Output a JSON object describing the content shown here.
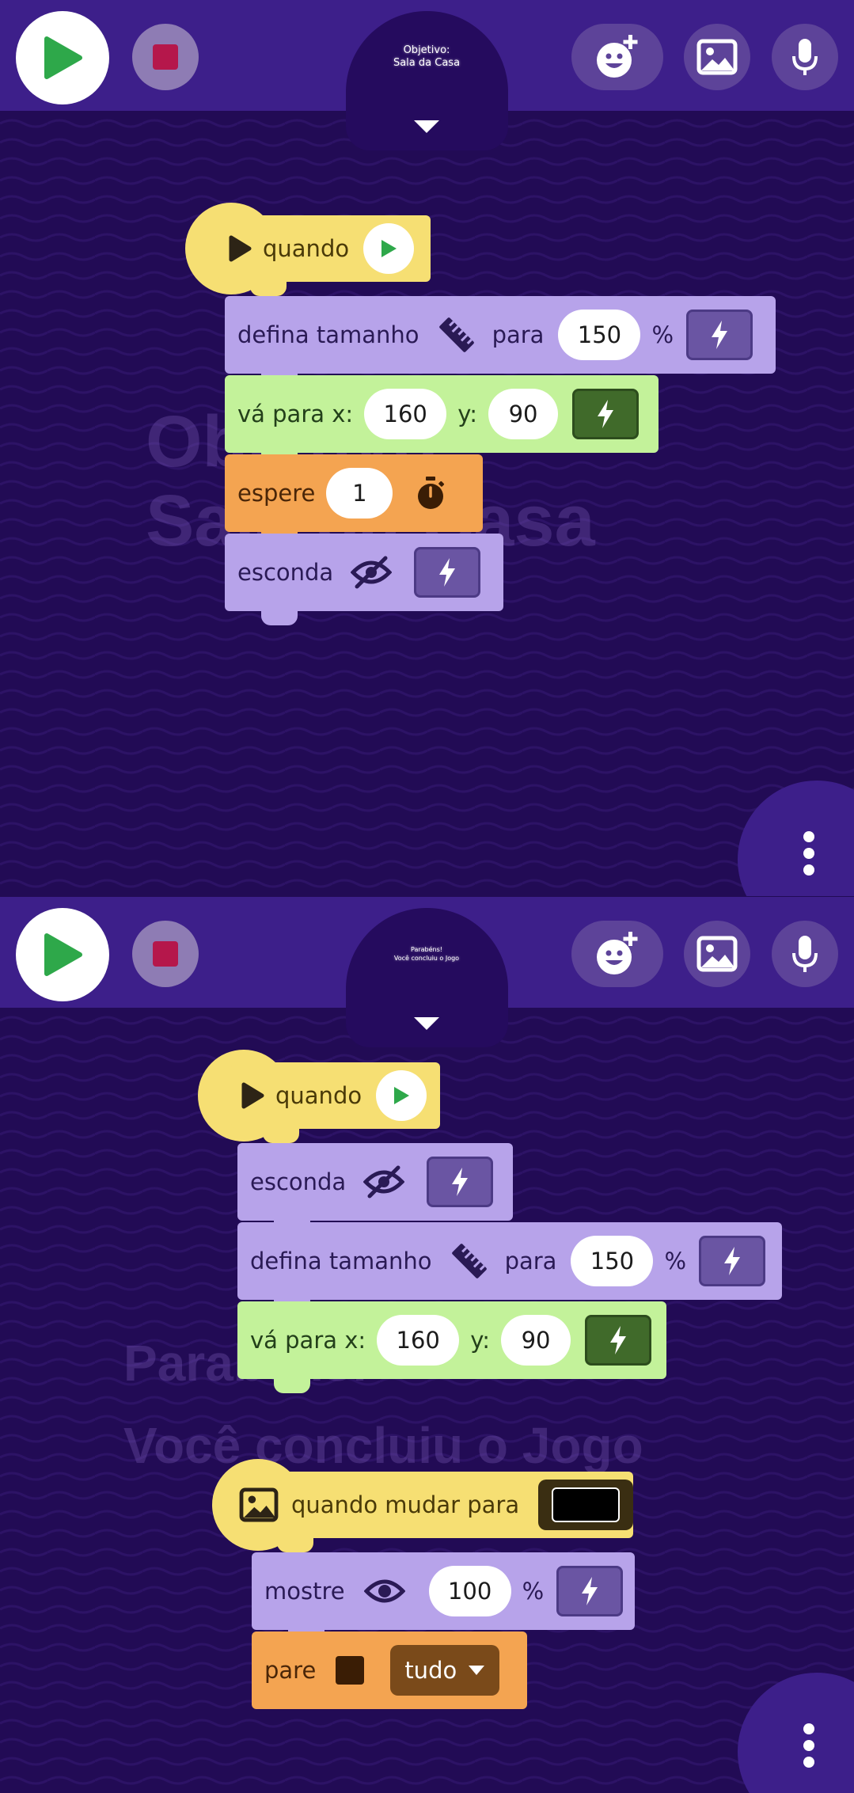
{
  "panels": [
    {
      "title_lines": [
        "Objetivo:",
        "Sala da Casa"
      ],
      "watermark_lines": [
        "Objetivo:",
        "Sala da Casa"
      ],
      "blocks": {
        "hat": {
          "label": "quando"
        },
        "b1": {
          "label": "defina tamanho",
          "connector": "para",
          "value": "150",
          "unit": "%"
        },
        "b2": {
          "label": "vá para x:",
          "x": "160",
          "ylabel": "y:",
          "y": "90"
        },
        "b3": {
          "label": "espere",
          "value": "1"
        },
        "b4": {
          "label": "esconda"
        }
      }
    },
    {
      "title_lines": [
        "Parabéns!",
        "Você concluiu o Jogo"
      ],
      "watermark_lines": [
        "Parabéns!",
        "Você concluiu o Jogo"
      ],
      "blocks": {
        "hat": {
          "label": "quando"
        },
        "b1": {
          "label": "esconda"
        },
        "b2": {
          "label": "defina tamanho",
          "connector": "para",
          "value": "150",
          "unit": "%"
        },
        "b3": {
          "label": "vá para x:",
          "x": "160",
          "ylabel": "y:",
          "y": "90"
        },
        "hat2": {
          "label": "quando mudar para",
          "swatch_color": "#000000"
        },
        "b4": {
          "label": "mostre",
          "value": "100",
          "unit": "%"
        },
        "b5": {
          "label": "pare",
          "dropdown": "tudo"
        }
      }
    }
  ],
  "colors": {
    "background": "#220b55",
    "topbar": "#3d1f8a",
    "play_green": "#2ea84a",
    "stop_red": "#b5174b",
    "block_purple": "#b7a3ea",
    "block_green": "#c3f29a",
    "block_orange": "#f4a451",
    "block_yellow": "#f6df73"
  },
  "icons": [
    "play-icon",
    "stop-icon",
    "add-character-icon",
    "image-icon",
    "microphone-icon",
    "lightning-icon",
    "ruler-icon",
    "stopwatch-icon",
    "eye-off-icon",
    "eye-icon",
    "more-vert-icon",
    "caret-down-icon"
  ]
}
